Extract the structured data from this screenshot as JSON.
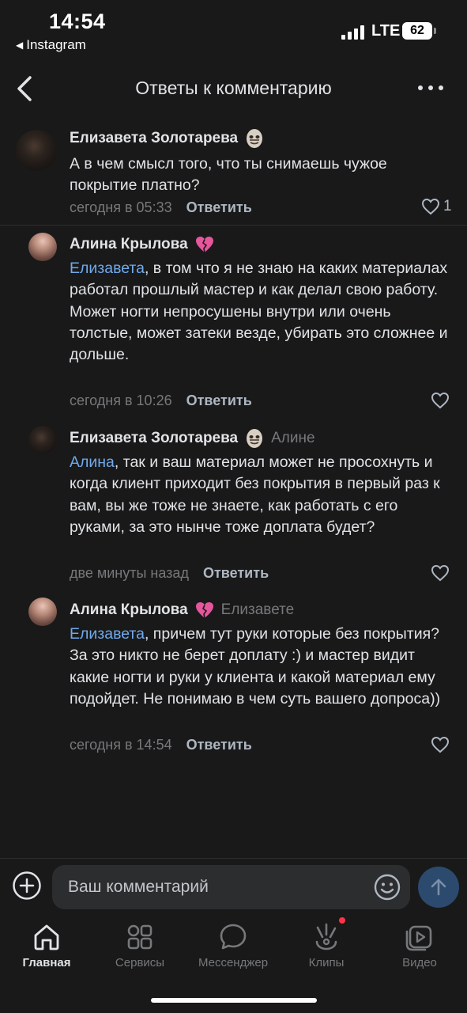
{
  "status_bar": {
    "time": "14:54",
    "back_app": "Instagram",
    "network": "LTE",
    "battery": "62"
  },
  "header": {
    "title": "Ответы к комментарию"
  },
  "comments": [
    {
      "author": "Елизавета Золотарева",
      "emoji": "skull-face-emoji",
      "reply_to": "",
      "mention": "",
      "text": "А в чем смысл того, что ты снимаешь чужое покрытие платно?",
      "time": "сегодня в 05:33",
      "reply_label": "Ответить",
      "likes": "1"
    },
    {
      "author": "Алина Крылова",
      "emoji": "broken-heart-emoji",
      "reply_to": "",
      "mention": "Елизавета",
      "text": ", в том что я не знаю на каких материалах работал прошлый мастер и как делал свою работу. Может ногти непросушены внутри или очень толстые, может затеки везде, убирать это сложнее и дольше.",
      "time": "сегодня в 10:26",
      "reply_label": "Ответить",
      "likes": ""
    },
    {
      "author": "Елизавета Золотарева",
      "emoji": "skull-face-emoji",
      "reply_to": "Алине",
      "mention": "Алина",
      "text": ", так и ваш материал может не просохнуть и когда клиент приходит без покрытия в первый раз к вам, вы же тоже не знаете, как работать с его руками, за это нынче тоже доплата будет?",
      "time": "две минуты назад",
      "reply_label": "Ответить",
      "likes": ""
    },
    {
      "author": "Алина Крылова",
      "emoji": "broken-heart-emoji",
      "reply_to": "Елизавете",
      "mention": "Елизавета",
      "text": ", причем тут руки которые без покрытия? За это никто не берет доплату :) и мастер видит какие ногти и руки у клиента и какой материал ему подойдет. Не понимаю в чем суть вашего допроса))",
      "time": "сегодня в 14:54",
      "reply_label": "Ответить",
      "likes": ""
    }
  ],
  "input": {
    "placeholder": "Ваш комментарий"
  },
  "tabs": [
    {
      "label": "Главная",
      "icon": "home-icon"
    },
    {
      "label": "Сервисы",
      "icon": "services-icon"
    },
    {
      "label": "Мессенджер",
      "icon": "messenger-icon"
    },
    {
      "label": "Клипы",
      "icon": "clips-icon"
    },
    {
      "label": "Видео",
      "icon": "video-icon"
    }
  ],
  "colors": {
    "background": "#19191a",
    "accent": "#71aaeb",
    "secondary_text": "#76787a",
    "notification": "#ff3347"
  }
}
